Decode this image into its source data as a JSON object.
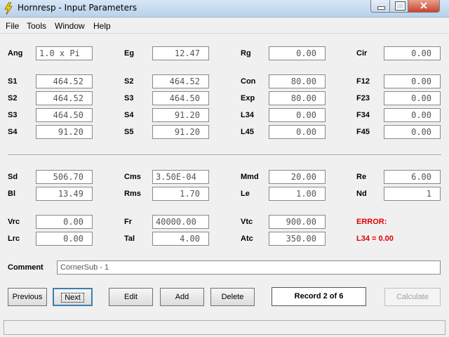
{
  "window": {
    "title": "Hornresp - Input Parameters",
    "close_glyph": "✕"
  },
  "menu": [
    "File",
    "Tools",
    "Window",
    "Help"
  ],
  "fields": {
    "Ang": "1.0 x Pi",
    "Eg": "12.47",
    "Rg": "0.00",
    "Cir": "0.00",
    "S1a": "464.52",
    "S2b": "464.52",
    "Con": "80.00",
    "F12": "0.00",
    "S2a": "464.52",
    "S3b": "464.50",
    "Exp": "80.00",
    "F23": "0.00",
    "S3a": "464.50",
    "S4b": "91.20",
    "L34": "0.00",
    "F34": "0.00",
    "S4a": "91.20",
    "S5b": "91.20",
    "L45": "0.00",
    "F45": "0.00",
    "Sd": "506.70",
    "Cms": "3.50E-04",
    "Mmd": "20.00",
    "Re": "6.00",
    "Bl": "13.49",
    "Rms": "1.70",
    "Le": "1.00",
    "Nd": "1",
    "Vrc": "0.00",
    "Fr": "40000.00",
    "Vtc": "900.00",
    "Lrc": "0.00",
    "Tal": "4.00",
    "Atc": "350.00"
  },
  "labels": {
    "Ang": "Ang",
    "Eg": "Eg",
    "Rg": "Rg",
    "Cir": "Cir",
    "S1a": "S1",
    "S2b": "S2",
    "Con": "Con",
    "F12": "F12",
    "S2a": "S2",
    "S3b": "S3",
    "Exp": "Exp",
    "F23": "F23",
    "S3a": "S3",
    "S4b": "S4",
    "L34": "L34",
    "F34": "F34",
    "S4a": "S4",
    "S5b": "S5",
    "L45": "L45",
    "F45": "F45",
    "Sd": "Sd",
    "Cms": "Cms",
    "Mmd": "Mmd",
    "Re": "Re",
    "Bl": "Bl",
    "Rms": "Rms",
    "Le": "Le",
    "Nd": "Nd",
    "Vrc": "Vrc",
    "Fr": "Fr",
    "Vtc": "Vtc",
    "Lrc": "Lrc",
    "Tal": "Tal",
    "Atc": "Atc"
  },
  "error": {
    "title": "ERROR:",
    "message": "L34 = 0.00"
  },
  "comment": {
    "label": "Comment",
    "value": "CornerSub - 1"
  },
  "buttons": {
    "previous": "Previous",
    "next": "Next",
    "edit": "Edit",
    "add": "Add",
    "delete": "Delete",
    "calculate": "Calculate"
  },
  "record": "Record 2 of 6",
  "icons": {
    "app": "lightning-bolt-icon"
  }
}
